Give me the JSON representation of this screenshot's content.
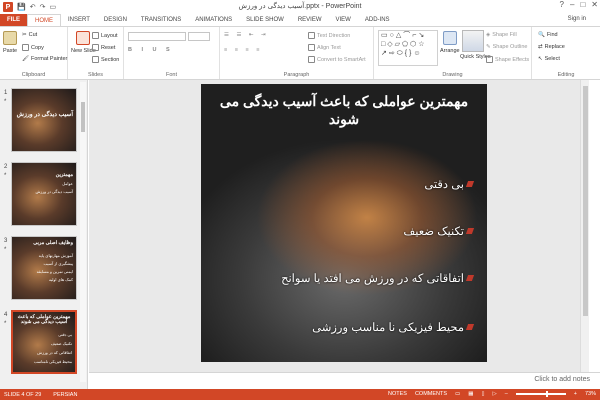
{
  "window": {
    "title": "آسیب دیدگی در ورزش.pptx - PowerPoint",
    "app_icon_letter": "P",
    "minimize": "–",
    "restore": "□",
    "close": "✕",
    "help": "?"
  },
  "tabs": [
    "FILE",
    "HOME",
    "INSERT",
    "DESIGN",
    "TRANSITIONS",
    "ANIMATIONS",
    "SLIDE SHOW",
    "REVIEW",
    "VIEW",
    "ADD-INS"
  ],
  "signin": "Sign in",
  "ribbon": {
    "clipboard": {
      "label": "Clipboard",
      "paste": "Paste",
      "cut": "Cut",
      "copy": "Copy",
      "format_painter": "Format Painter"
    },
    "slides": {
      "label": "Slides",
      "new_slide": "New Slide",
      "layout": "Layout",
      "reset": "Reset",
      "section": "Section"
    },
    "font": {
      "label": "Font"
    },
    "paragraph": {
      "label": "Paragraph",
      "text_direction": "Text Direction",
      "align_text": "Align Text",
      "convert": "Convert to SmartArt"
    },
    "drawing": {
      "label": "Drawing",
      "arrange": "Arrange",
      "quick_styles": "Quick Styles",
      "shape_fill": "Shape Fill",
      "shape_outline": "Shape Outline",
      "shape_effects": "Shape Effects"
    },
    "editing": {
      "label": "Editing",
      "find": "Find",
      "replace": "Replace",
      "select": "Select"
    }
  },
  "thumbnails": [
    {
      "num": "1",
      "star": "*",
      "lines": [
        "آسیب دیدگی در ورزش"
      ]
    },
    {
      "num": "2",
      "star": "*",
      "lines": [
        "مهمترین",
        "عوامل",
        "آسیب دیدگی در ورزش"
      ]
    },
    {
      "num": "3",
      "star": "*",
      "lines": [
        "وظایف اصلی مربی",
        "آموزش مهارتهای پایه",
        "پیشگیری از آسیب",
        "ایمنی تمرین و مسابقه",
        "کمک های اولیه"
      ]
    },
    {
      "num": "4",
      "star": "*",
      "lines": [
        "مهمترین عواملی که باعث آسیب دیدگی می شوند",
        "بی دقتی",
        "تکنیک ضعیف",
        "اتفاقاتی که در ورزش",
        "محیط فیزیکی نامناسب"
      ]
    }
  ],
  "slide": {
    "title": "مهمترین عواملی که باعث آسیب دیدگی می شوند",
    "bullets": [
      "بی دقتی",
      "تکنیک ضعیف",
      "اتفاقاتی که در ورزش می افتد یا سوانح",
      "محیط فیزیکی نا مناسب ورزشی"
    ]
  },
  "notes_placeholder": "Click to add notes",
  "status": {
    "slide_of": "SLIDE 4 OF 29",
    "language": "PERSIAN",
    "notes": "NOTES",
    "comments": "COMMENTS",
    "zoom": "73%"
  },
  "colors": {
    "accent": "#d24726"
  }
}
